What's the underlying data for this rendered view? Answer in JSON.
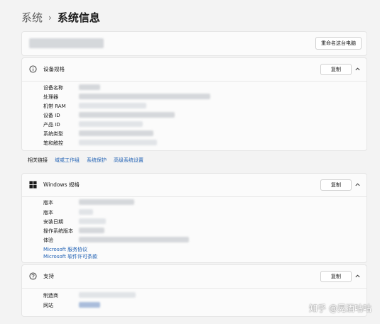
{
  "breadcrumb": {
    "parent": "系统",
    "separator": "›",
    "current": "系统信息"
  },
  "top": {
    "rename_button": "重命名这台电脑"
  },
  "device_specs": {
    "title": "设备规格",
    "copy_button": "复制",
    "fields": [
      "设备名称",
      "处理器",
      "机带 RAM",
      "设备 ID",
      "产品 ID",
      "系统类型",
      "笔和触控"
    ]
  },
  "related": {
    "label": "相关链接",
    "links": [
      "域或工作组",
      "系统保护",
      "高级系统设置"
    ]
  },
  "windows_specs": {
    "title": "Windows 规格",
    "copy_button": "复制",
    "fields": [
      "版本",
      "版本",
      "安装日期",
      "操作系统版本",
      "体验"
    ],
    "links": [
      "Microsoft 服务协议",
      "Microsoft 软件许可条款"
    ]
  },
  "support": {
    "title": "支持",
    "copy_button": "复制",
    "fields": [
      "制造商",
      "网站"
    ]
  },
  "watermark": "知乎 @晃酒咕咕"
}
